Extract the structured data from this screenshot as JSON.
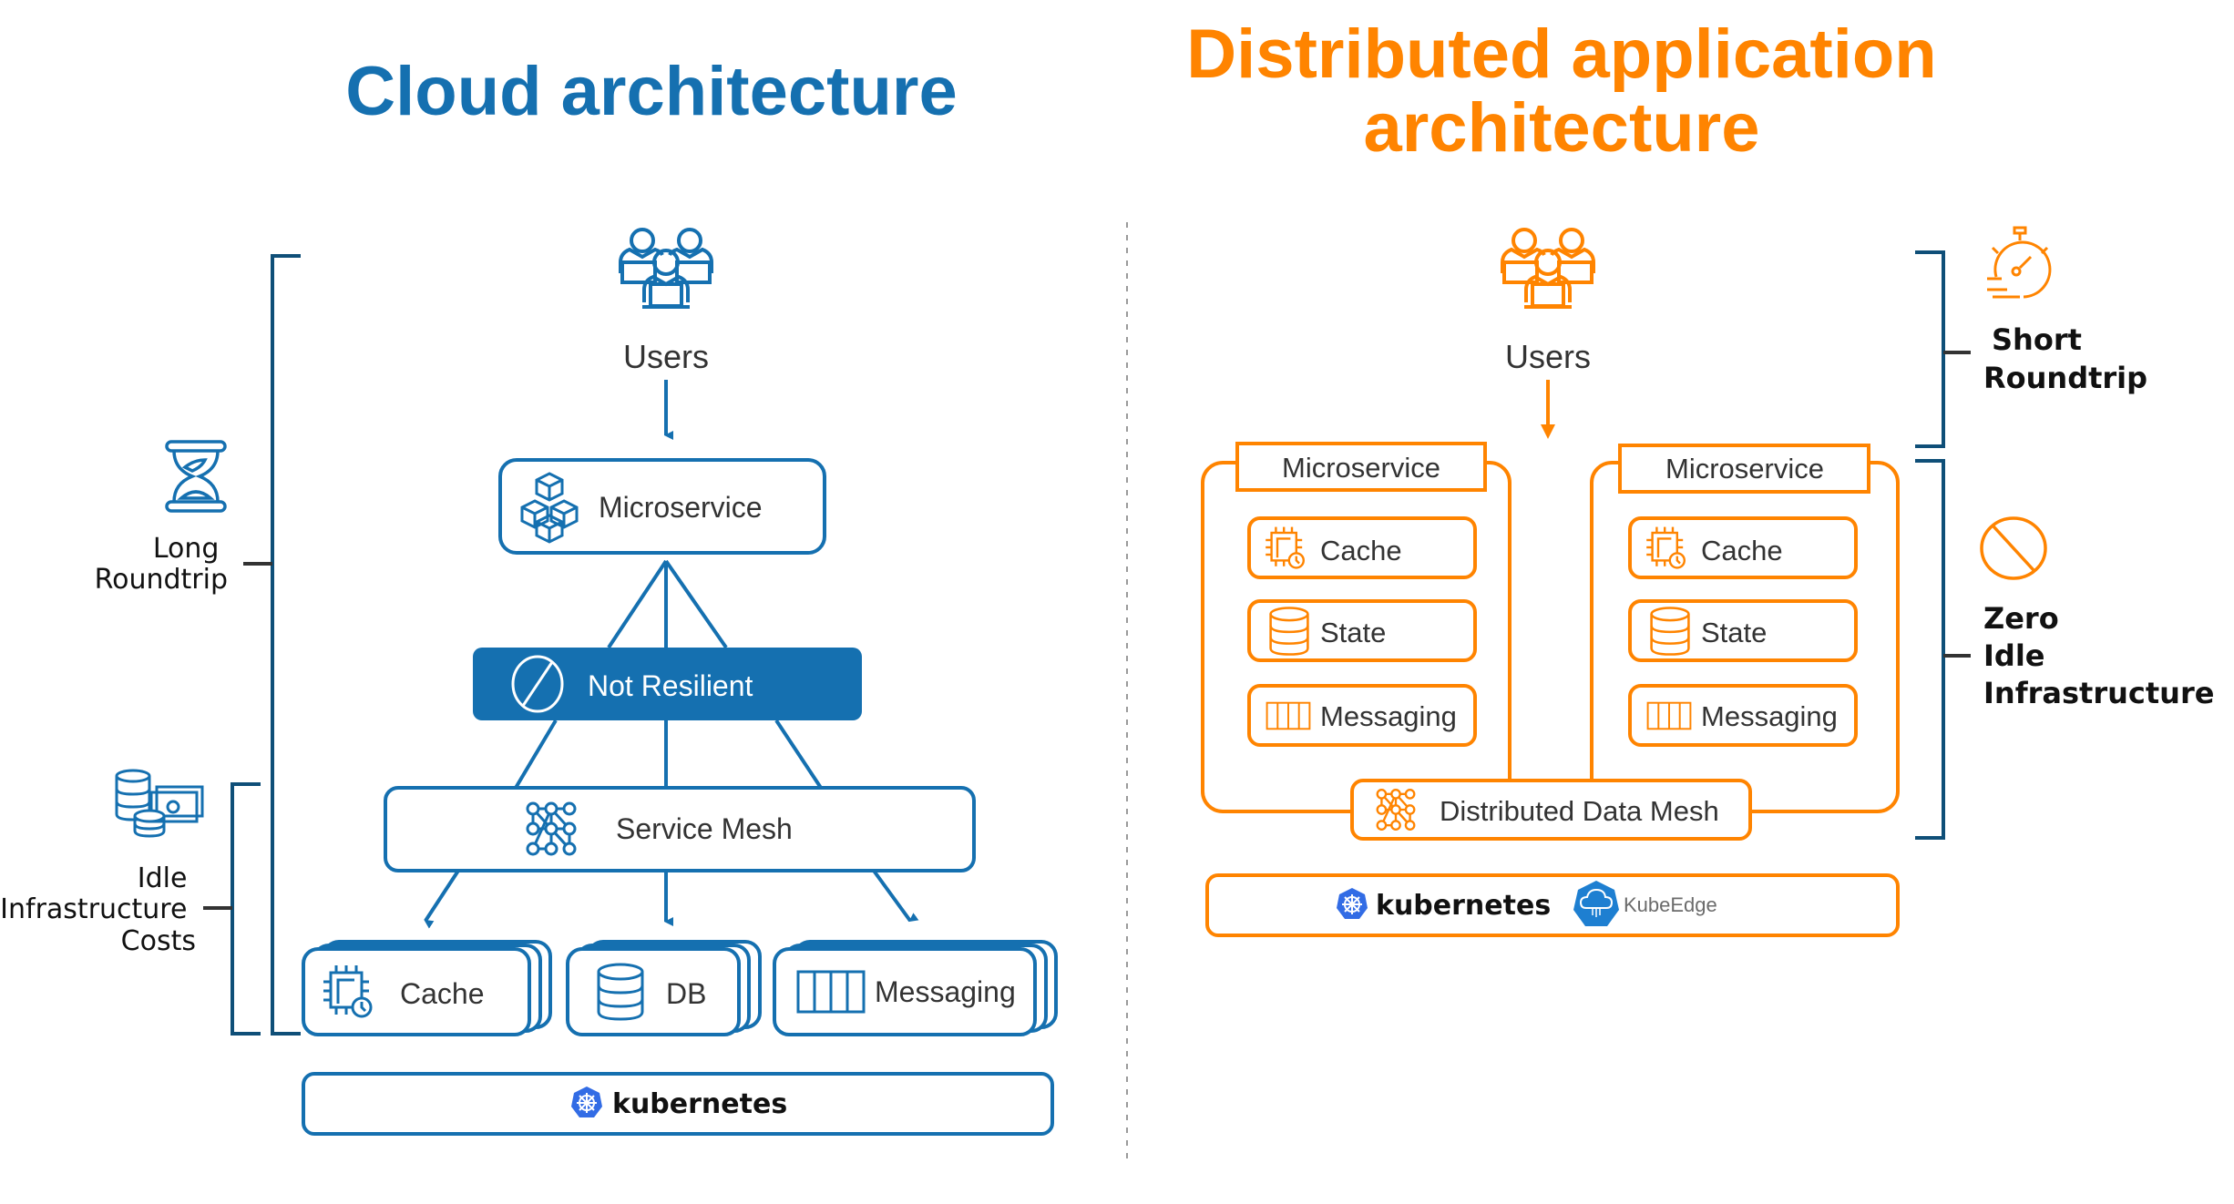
{
  "colors": {
    "blue": "#1570b0",
    "bracket_blue": "#0f4f78",
    "orange": "#ff8400",
    "text": "#333333",
    "k8s_blue": "#326ce5"
  },
  "left": {
    "title": "Cloud architecture",
    "users_label": "Users",
    "microservice_label": "Microservice",
    "not_resilient_label": "Not Resilient",
    "service_mesh_label": "Service Mesh",
    "services": [
      {
        "label": "Cache",
        "icon": "chip-clock-icon"
      },
      {
        "label": "DB",
        "icon": "database-icon"
      },
      {
        "label": "Messaging",
        "icon": "queue-icon"
      }
    ],
    "platform_label": "kubernetes",
    "annotations": {
      "long_roundtrip": [
        "Long",
        "Roundtrip"
      ],
      "idle_costs": [
        "Idle",
        "Infrastructure",
        "Costs"
      ]
    }
  },
  "right": {
    "title_line1": "Distributed application",
    "title_line2": "architecture",
    "users_label": "Users",
    "microservices": [
      {
        "label": "Microservice",
        "components": [
          "Cache",
          "State",
          "Messaging"
        ]
      },
      {
        "label": "Microservice",
        "components": [
          "Cache",
          "State",
          "Messaging"
        ]
      }
    ],
    "data_mesh_label": "Distributed Data Mesh",
    "platforms": [
      "kubernetes",
      "KubeEdge"
    ],
    "annotations": {
      "short_roundtrip": [
        "Short",
        "Roundtrip"
      ],
      "zero_idle": [
        "Zero",
        "Idle",
        "Infrastructure"
      ]
    }
  }
}
